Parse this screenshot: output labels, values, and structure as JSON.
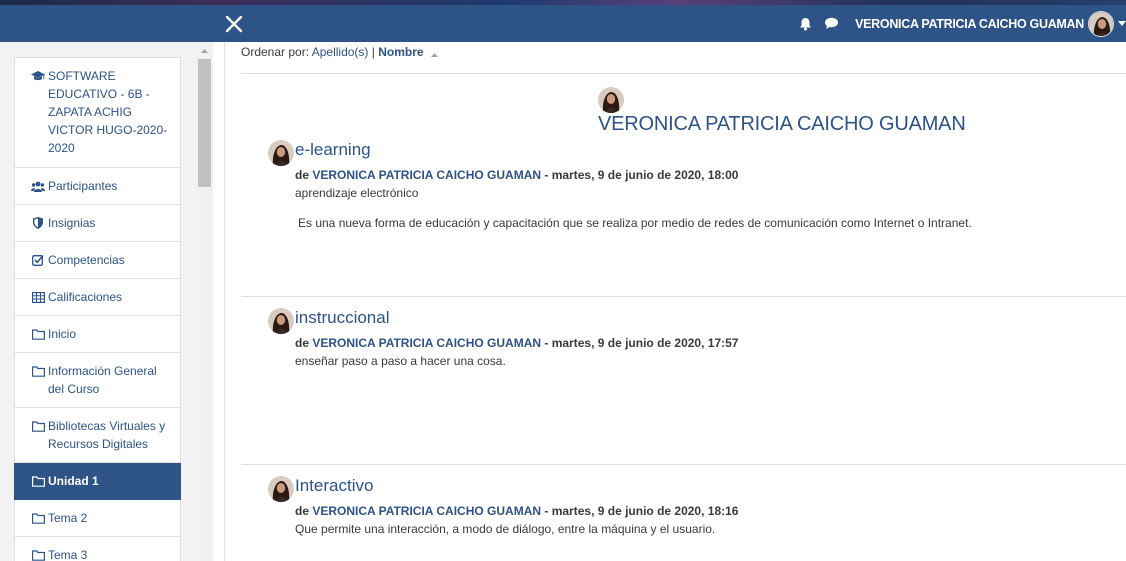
{
  "navbar": {
    "user_name": "VERONICA PATRICIA CAICHO GUAMAN"
  },
  "drawer": {
    "items": [
      {
        "label": "SOFTWARE EDUCATIVO - 6B - ZAPATA ACHIG VICTOR HUGO-2020-2020",
        "icon": "graduation-cap-icon"
      },
      {
        "label": "Participantes",
        "icon": "users-icon"
      },
      {
        "label": "Insignias",
        "icon": "shield-icon"
      },
      {
        "label": "Competencias",
        "icon": "checkbox-icon"
      },
      {
        "label": "Calificaciones",
        "icon": "table-icon"
      },
      {
        "label": "Inicio",
        "icon": "folder-icon"
      },
      {
        "label": "Información General del Curso",
        "icon": "folder-icon"
      },
      {
        "label": "Bibliotecas Virtuales y Recursos Digitales",
        "icon": "folder-icon"
      },
      {
        "label": "Unidad 1",
        "icon": "folder-icon",
        "active": true
      },
      {
        "label": "Tema 2",
        "icon": "folder-icon"
      },
      {
        "label": "Tema 3",
        "icon": "folder-icon"
      }
    ]
  },
  "sort": {
    "prefix": "Ordenar por:",
    "option_lastname": "Apellido(s)",
    "separator": "|",
    "option_name": "Nombre"
  },
  "author_heading": "VERONICA PATRICIA CAICHO GUAMAN",
  "entries": [
    {
      "title": "e-learning",
      "by": "de",
      "author": "VERONICA PATRICIA CAICHO GUAMAN",
      "date": "- martes, 9 de junio de 2020, 18:00",
      "definition": "aprendizaje electrónico",
      "description": "Es una nueva forma de educación y capacitación que se realiza por medio de redes de comunicación como Internet o Intranet."
    },
    {
      "title": "instruccional",
      "by": "de",
      "author": "VERONICA PATRICIA CAICHO GUAMAN",
      "date": "- martes, 9 de junio de 2020, 17:57",
      "definition": "enseñar paso a paso a hacer una cosa.",
      "description": ""
    },
    {
      "title": "Interactivo",
      "by": "de",
      "author": "VERONICA PATRICIA CAICHO GUAMAN",
      "date": "- martes, 9 de junio de 2020, 18:16",
      "definition": "Que permite una interacción, a modo de diálogo, entre la máquina y el usuario.",
      "description": ""
    }
  ],
  "colors": {
    "navbar": "#2d5387",
    "link": "#2d5387",
    "active_item": "#2d5387"
  }
}
